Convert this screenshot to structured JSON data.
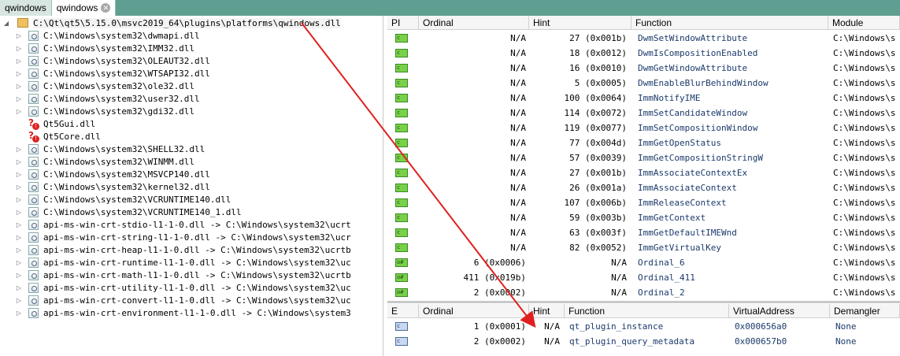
{
  "tabs": [
    {
      "label": "qwindows",
      "active": false
    },
    {
      "label": "qwindows",
      "active": true
    }
  ],
  "tree": {
    "root": "C:\\Qt\\qt5\\5.15.0\\msvc2019_64\\plugins\\platforms\\qwindows.dll",
    "items": [
      {
        "label": "C:\\Windows\\system32\\dwmapi.dll",
        "icon": "dll-icon",
        "expandable": true
      },
      {
        "label": "C:\\Windows\\system32\\IMM32.dll",
        "icon": "dll-icon",
        "expandable": true
      },
      {
        "label": "C:\\Windows\\system32\\OLEAUT32.dll",
        "icon": "dll-icon",
        "expandable": true
      },
      {
        "label": "C:\\Windows\\system32\\WTSAPI32.dll",
        "icon": "dll-icon",
        "expandable": true
      },
      {
        "label": "C:\\Windows\\system32\\ole32.dll",
        "icon": "dll-icon",
        "expandable": true
      },
      {
        "label": "C:\\Windows\\system32\\user32.dll",
        "icon": "dll-icon",
        "expandable": true
      },
      {
        "label": "C:\\Windows\\system32\\gdi32.dll",
        "icon": "dll-icon",
        "expandable": true
      },
      {
        "label": "Qt5Gui.dll",
        "icon": "missing-dll-icon",
        "expandable": false
      },
      {
        "label": "Qt5Core.dll",
        "icon": "missing-dll-icon",
        "expandable": false
      },
      {
        "label": "C:\\Windows\\system32\\SHELL32.dll",
        "icon": "dll-icon",
        "expandable": true
      },
      {
        "label": "C:\\Windows\\system32\\WINMM.dll",
        "icon": "dll-icon",
        "expandable": true
      },
      {
        "label": "C:\\Windows\\system32\\MSVCP140.dll",
        "icon": "dll-icon",
        "expandable": true
      },
      {
        "label": "C:\\Windows\\system32\\kernel32.dll",
        "icon": "dll-icon",
        "expandable": true
      },
      {
        "label": "C:\\Windows\\system32\\VCRUNTIME140.dll",
        "icon": "dll-icon",
        "expandable": true
      },
      {
        "label": "C:\\Windows\\system32\\VCRUNTIME140_1.dll",
        "icon": "dll-icon",
        "expandable": true
      },
      {
        "label": "api-ms-win-crt-stdio-l1-1-0.dll -> C:\\Windows\\system32\\ucrt",
        "icon": "dll-icon",
        "expandable": true
      },
      {
        "label": "api-ms-win-crt-string-l1-1-0.dll -> C:\\Windows\\system32\\ucr",
        "icon": "dll-icon",
        "expandable": true
      },
      {
        "label": "api-ms-win-crt-heap-l1-1-0.dll -> C:\\Windows\\system32\\ucrtb",
        "icon": "dll-icon",
        "expandable": true
      },
      {
        "label": "api-ms-win-crt-runtime-l1-1-0.dll -> C:\\Windows\\system32\\uc",
        "icon": "dll-icon",
        "expandable": true
      },
      {
        "label": "api-ms-win-crt-math-l1-1-0.dll -> C:\\Windows\\system32\\ucrtb",
        "icon": "dll-icon",
        "expandable": true
      },
      {
        "label": "api-ms-win-crt-utility-l1-1-0.dll -> C:\\Windows\\system32\\uc",
        "icon": "dll-icon",
        "expandable": true
      },
      {
        "label": "api-ms-win-crt-convert-l1-1-0.dll -> C:\\Windows\\system32\\uc",
        "icon": "dll-icon",
        "expandable": true
      },
      {
        "label": "api-ms-win-crt-environment-l1-1-0.dll -> C:\\Windows\\system3",
        "icon": "dll-icon",
        "expandable": true
      }
    ]
  },
  "imports": {
    "columns": [
      "PI",
      "Ordinal",
      "Hint",
      "Function",
      "Module"
    ],
    "rows": [
      {
        "pi": "c",
        "ordinal": "N/A",
        "hint": "27 (0x001b)",
        "function": "DwmSetWindowAttribute",
        "module": "C:\\Windows\\s"
      },
      {
        "pi": "c",
        "ordinal": "N/A",
        "hint": "18 (0x0012)",
        "function": "DwmIsCompositionEnabled",
        "module": "C:\\Windows\\s"
      },
      {
        "pi": "c",
        "ordinal": "N/A",
        "hint": "16 (0x0010)",
        "function": "DwmGetWindowAttribute",
        "module": "C:\\Windows\\s"
      },
      {
        "pi": "c",
        "ordinal": "N/A",
        "hint": "5 (0x0005)",
        "function": "DwmEnableBlurBehindWindow",
        "module": "C:\\Windows\\s"
      },
      {
        "pi": "c",
        "ordinal": "N/A",
        "hint": "100 (0x0064)",
        "function": "ImmNotifyIME",
        "module": "C:\\Windows\\s"
      },
      {
        "pi": "c",
        "ordinal": "N/A",
        "hint": "114 (0x0072)",
        "function": "ImmSetCandidateWindow",
        "module": "C:\\Windows\\s"
      },
      {
        "pi": "c",
        "ordinal": "N/A",
        "hint": "119 (0x0077)",
        "function": "ImmSetCompositionWindow",
        "module": "C:\\Windows\\s"
      },
      {
        "pi": "c",
        "ordinal": "N/A",
        "hint": "77 (0x004d)",
        "function": "ImmGetOpenStatus",
        "module": "C:\\Windows\\s"
      },
      {
        "pi": "c",
        "ordinal": "N/A",
        "hint": "57 (0x0039)",
        "function": "ImmGetCompositionStringW",
        "module": "C:\\Windows\\s"
      },
      {
        "pi": "c",
        "ordinal": "N/A",
        "hint": "27 (0x001b)",
        "function": "ImmAssociateContextEx",
        "module": "C:\\Windows\\s"
      },
      {
        "pi": "c",
        "ordinal": "N/A",
        "hint": "26 (0x001a)",
        "function": "ImmAssociateContext",
        "module": "C:\\Windows\\s"
      },
      {
        "pi": "c",
        "ordinal": "N/A",
        "hint": "107 (0x006b)",
        "function": "ImmReleaseContext",
        "module": "C:\\Windows\\s"
      },
      {
        "pi": "c",
        "ordinal": "N/A",
        "hint": "59 (0x003b)",
        "function": "ImmGetContext",
        "module": "C:\\Windows\\s"
      },
      {
        "pi": "c",
        "ordinal": "N/A",
        "hint": "63 (0x003f)",
        "function": "ImmGetDefaultIMEWnd",
        "module": "C:\\Windows\\s"
      },
      {
        "pi": "c",
        "ordinal": "N/A",
        "hint": "82 (0x0052)",
        "function": "ImmGetVirtualKey",
        "module": "C:\\Windows\\s"
      },
      {
        "pi": "o#",
        "ordinal": "6 (0x0006)",
        "hint": "N/A",
        "function": "Ordinal_6",
        "module": "C:\\Windows\\s"
      },
      {
        "pi": "o#",
        "ordinal": "411 (0x019b)",
        "hint": "N/A",
        "function": "Ordinal_411",
        "module": "C:\\Windows\\s"
      },
      {
        "pi": "o#",
        "ordinal": "2 (0x0002)",
        "hint": "N/A",
        "function": "Ordinal_2",
        "module": "C:\\Windows\\s"
      }
    ]
  },
  "exports": {
    "columns": [
      "E",
      "Ordinal",
      "Hint",
      "Function",
      "VirtualAddress",
      "Demangler"
    ],
    "rows": [
      {
        "e": "c",
        "ordinal": "1 (0x0001)",
        "hint": "N/A",
        "function": "qt_plugin_instance",
        "address": "0x000656a0",
        "demangled": "None"
      },
      {
        "e": "c",
        "ordinal": "2 (0x0002)",
        "hint": "N/A",
        "function": "qt_plugin_query_metadata",
        "address": "0x000657b0",
        "demangled": "None"
      }
    ]
  },
  "colors": {
    "accent": "#5f9f91",
    "arrow": "#e02020",
    "function_text": "#1b3a6b"
  }
}
